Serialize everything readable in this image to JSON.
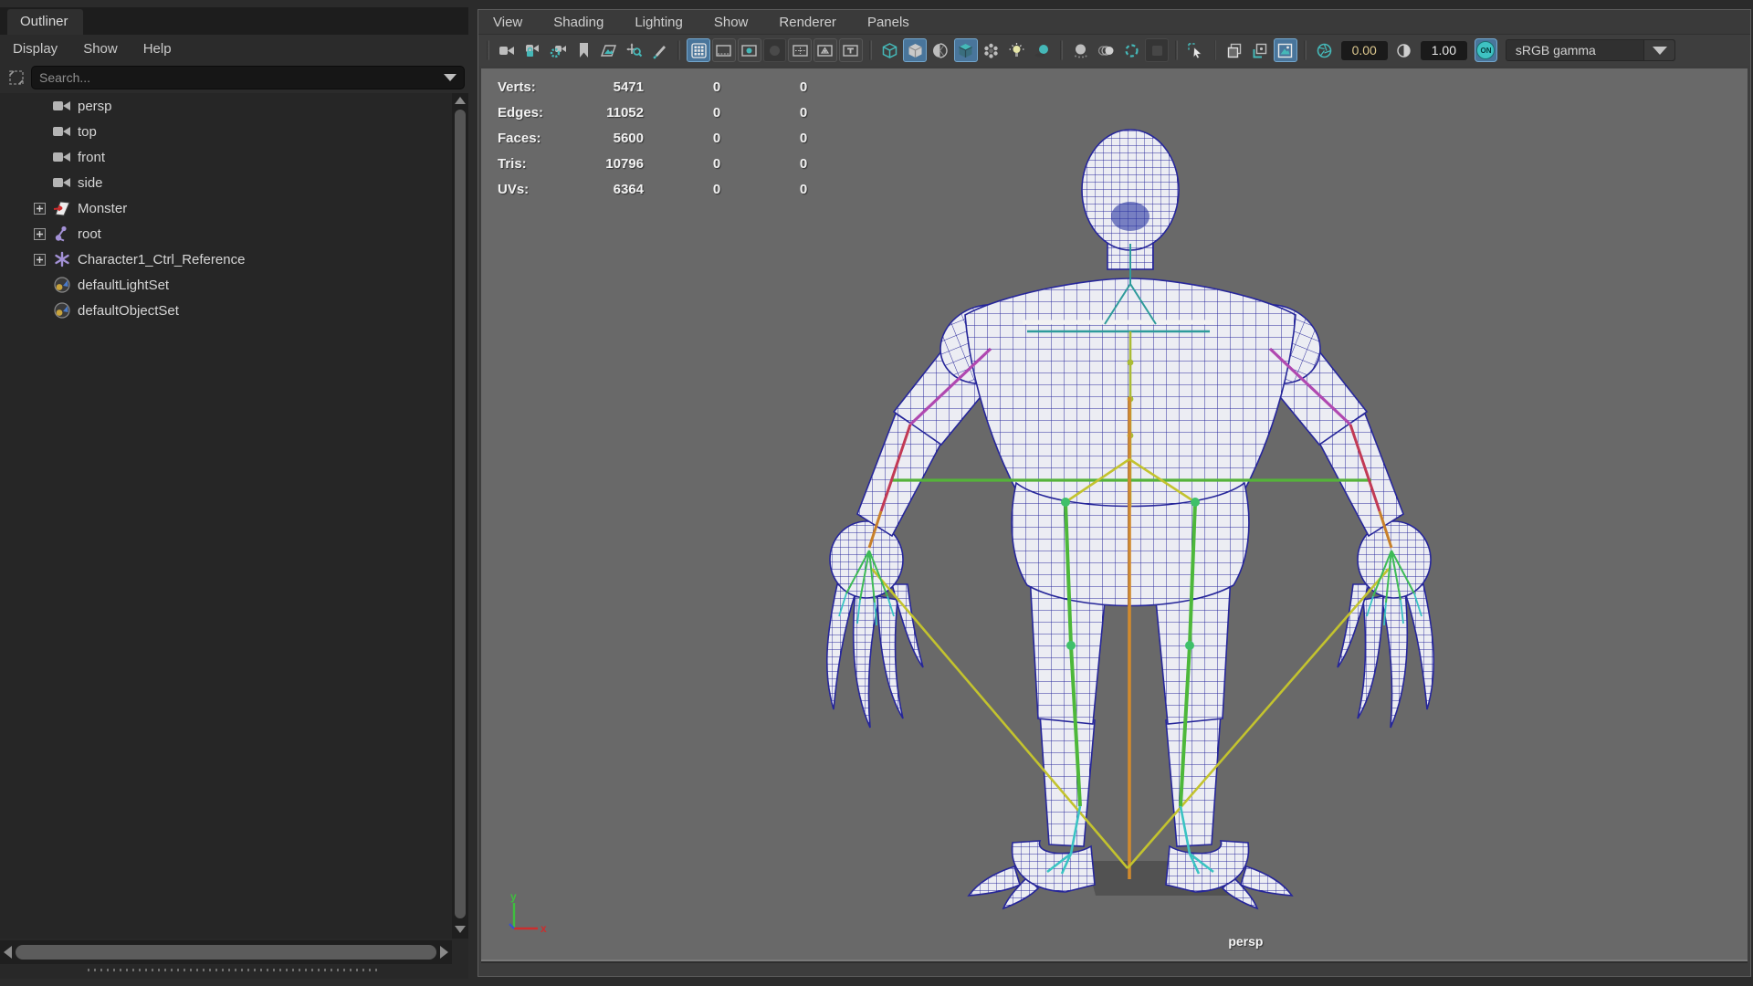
{
  "outliner": {
    "tab_label": "Outliner",
    "menus": [
      {
        "label": "Display"
      },
      {
        "label": "Show"
      },
      {
        "label": "Help"
      }
    ],
    "search": {
      "placeholder": "Search..."
    },
    "items": [
      {
        "label": "persp",
        "icon": "camera-icon",
        "expandable": false
      },
      {
        "label": "top",
        "icon": "camera-icon",
        "expandable": false
      },
      {
        "label": "front",
        "icon": "camera-icon",
        "expandable": false
      },
      {
        "label": "side",
        "icon": "camera-icon",
        "expandable": false
      },
      {
        "label": "Monster",
        "icon": "polymesh-icon",
        "expandable": true
      },
      {
        "label": "root",
        "icon": "joint-icon",
        "expandable": true
      },
      {
        "label": "Character1_Ctrl_Reference",
        "icon": "character-set-icon",
        "expandable": true
      },
      {
        "label": "defaultLightSet",
        "icon": "object-set-icon",
        "expandable": false
      },
      {
        "label": "defaultObjectSet",
        "icon": "object-set-icon",
        "expandable": false
      }
    ]
  },
  "viewport": {
    "menus": [
      {
        "label": "View"
      },
      {
        "label": "Shading"
      },
      {
        "label": "Lighting"
      },
      {
        "label": "Show"
      },
      {
        "label": "Renderer"
      },
      {
        "label": "Panels"
      }
    ],
    "toolbar": {
      "exposure": "0.00",
      "gamma": "1.00",
      "on_toggle": "ON",
      "color_profile": "sRGB gamma"
    },
    "hud": {
      "rows": [
        {
          "label": "Verts:",
          "total": "5471",
          "c2": "0",
          "c3": "0"
        },
        {
          "label": "Edges:",
          "total": "11052",
          "c2": "0",
          "c3": "0"
        },
        {
          "label": "Faces:",
          "total": "5600",
          "c2": "0",
          "c3": "0"
        },
        {
          "label": "Tris:",
          "total": "10796",
          "c2": "0",
          "c3": "0"
        },
        {
          "label": "UVs:",
          "total": "6364",
          "c2": "0",
          "c3": "0"
        }
      ]
    },
    "camera_label": "persp",
    "axis_labels": {
      "x": "x",
      "y": "y"
    }
  },
  "colors": {
    "viewport_bg": "#696969",
    "wireframe": "#2b2b9c",
    "accent_teal": "#45b8b8",
    "active_button": "#49759b",
    "bone_green": "#4db83a",
    "bone_yellow": "#c3c32e",
    "bone_orange": "#d08a2e",
    "bone_magenta": "#b048b0",
    "bone_cyan": "#3ac3c3"
  }
}
